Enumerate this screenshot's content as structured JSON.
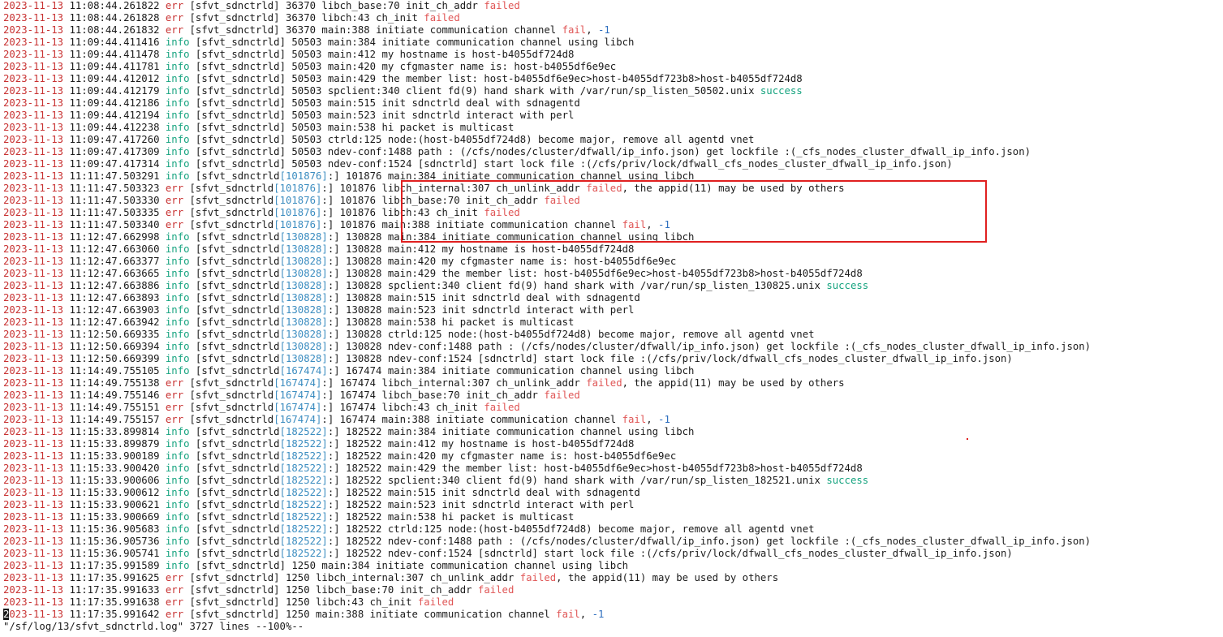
{
  "colors": {
    "date": "#c83232",
    "err": "#c83232",
    "info": "#16a37f",
    "failed": "#e05656",
    "success": "#16a37f",
    "pid_bracket": "#3c8dc0",
    "neg_one": "#2f6fbf",
    "highlight_box": "#e02020"
  },
  "log": {
    "lines": [
      {
        "d": "2023-11-13",
        "t": "11:08:44.261822",
        "l": "err",
        "tag": "[sfvt_sdnctrld]",
        "pid": "",
        "pid2": "36370",
        "src": "libch_base:70",
        "msg": [
          [
            "init_ch_addr ",
            ""
          ],
          [
            "failed",
            "fail"
          ]
        ]
      },
      {
        "d": "2023-11-13",
        "t": "11:08:44.261828",
        "l": "err",
        "tag": "[sfvt_sdnctrld]",
        "pid": "",
        "pid2": "36370",
        "src": "libch:43",
        "msg": [
          [
            "ch_init ",
            ""
          ],
          [
            "failed",
            "fail"
          ]
        ]
      },
      {
        "d": "2023-11-13",
        "t": "11:08:44.261832",
        "l": "err",
        "tag": "[sfvt_sdnctrld]",
        "pid": "",
        "pid2": "36370",
        "src": "main:388",
        "msg": [
          [
            "initiate communication channel ",
            ""
          ],
          [
            "fail",
            "fail"
          ],
          [
            ", ",
            ""
          ],
          [
            "-1",
            "neg"
          ]
        ]
      },
      {
        "d": "2023-11-13",
        "t": "11:09:44.411416",
        "l": "info",
        "tag": "[sfvt_sdnctrld]",
        "pid": "",
        "pid2": "50503",
        "src": "main:384",
        "msg": [
          [
            "initiate communication channel using libch",
            ""
          ]
        ]
      },
      {
        "d": "2023-11-13",
        "t": "11:09:44.411478",
        "l": "info",
        "tag": "[sfvt_sdnctrld]",
        "pid": "",
        "pid2": "50503",
        "src": "main:412",
        "msg": [
          [
            "my hostname is host-b4055df724d8",
            ""
          ]
        ]
      },
      {
        "d": "2023-11-13",
        "t": "11:09:44.411781",
        "l": "info",
        "tag": "[sfvt_sdnctrld]",
        "pid": "",
        "pid2": "50503",
        "src": "main:420",
        "msg": [
          [
            "my cfgmaster name is: host-b4055df6e9ec",
            ""
          ]
        ]
      },
      {
        "d": "2023-11-13",
        "t": "11:09:44.412012",
        "l": "info",
        "tag": "[sfvt_sdnctrld]",
        "pid": "",
        "pid2": "50503",
        "src": "main:429",
        "msg": [
          [
            "the member list: host-b4055df6e9ec>host-b4055df723b8>host-b4055df724d8",
            ""
          ]
        ]
      },
      {
        "d": "2023-11-13",
        "t": "11:09:44.412179",
        "l": "info",
        "tag": "[sfvt_sdnctrld]",
        "pid": "",
        "pid2": "50503",
        "src": "spclient:340",
        "msg": [
          [
            "client fd(9) hand shark with /var/run/sp_listen_50502.unix ",
            ""
          ],
          [
            "success",
            "ok"
          ]
        ]
      },
      {
        "d": "2023-11-13",
        "t": "11:09:44.412186",
        "l": "info",
        "tag": "[sfvt_sdnctrld]",
        "pid": "",
        "pid2": "50503",
        "src": "main:515",
        "msg": [
          [
            "init sdnctrld deal with sdnagentd",
            ""
          ]
        ]
      },
      {
        "d": "2023-11-13",
        "t": "11:09:44.412194",
        "l": "info",
        "tag": "[sfvt_sdnctrld]",
        "pid": "",
        "pid2": "50503",
        "src": "main:523",
        "msg": [
          [
            "init sdnctrld interact with perl",
            ""
          ]
        ]
      },
      {
        "d": "2023-11-13",
        "t": "11:09:44.412238",
        "l": "info",
        "tag": "[sfvt_sdnctrld]",
        "pid": "",
        "pid2": "50503",
        "src": "main:538",
        "msg": [
          [
            "hi packet is multicast",
            ""
          ]
        ]
      },
      {
        "d": "2023-11-13",
        "t": "11:09:47.417260",
        "l": "info",
        "tag": "[sfvt_sdnctrld]",
        "pid": "",
        "pid2": "50503",
        "src": "ctrld:125",
        "msg": [
          [
            "node:(host-b4055df724d8) become major, remove all agentd vnet",
            ""
          ]
        ]
      },
      {
        "d": "2023-11-13",
        "t": "11:09:47.417309",
        "l": "info",
        "tag": "[sfvt_sdnctrld]",
        "pid": "",
        "pid2": "50503",
        "src": "ndev-conf:1488",
        "msg": [
          [
            "path : (/cfs/nodes/cluster/dfwall/ip_info.json) get lockfile :(_cfs_nodes_cluster_dfwall_ip_info.json)",
            ""
          ]
        ]
      },
      {
        "d": "2023-11-13",
        "t": "11:09:47.417314",
        "l": "info",
        "tag": "[sfvt_sdnctrld]",
        "pid": "",
        "pid2": "50503",
        "src": "ndev-conf:1524",
        "msg": [
          [
            "[sdnctrld] start lock file :(/cfs/priv/lock/dfwall_cfs_nodes_cluster_dfwall_ip_info.json)",
            ""
          ]
        ]
      },
      {
        "d": "2023-11-13",
        "t": "11:11:47.503291",
        "l": "info",
        "tag": "[sfvt_sdnctrld",
        "pid": "[101876]",
        "pid2": "101876",
        "src": "main:384",
        "msg": [
          [
            "initiate communication channel using libch",
            ""
          ]
        ]
      },
      {
        "d": "2023-11-13",
        "t": "11:11:47.503323",
        "l": "err",
        "tag": "[sfvt_sdnctrld",
        "pid": "[101876]",
        "pid2": "101876",
        "src": "libch_internal:307",
        "msg": [
          [
            "ch_unlink_addr ",
            ""
          ],
          [
            "failed",
            "fail"
          ],
          [
            ", the appid(11) may be used by others",
            ""
          ]
        ]
      },
      {
        "d": "2023-11-13",
        "t": "11:11:47.503330",
        "l": "err",
        "tag": "[sfvt_sdnctrld",
        "pid": "[101876]",
        "pid2": "101876",
        "src": "libch_base:70",
        "msg": [
          [
            "init_ch_addr ",
            ""
          ],
          [
            "failed",
            "fail"
          ]
        ]
      },
      {
        "d": "2023-11-13",
        "t": "11:11:47.503335",
        "l": "err",
        "tag": "[sfvt_sdnctrld",
        "pid": "[101876]",
        "pid2": "101876",
        "src": "libch:43",
        "msg": [
          [
            "ch_init ",
            ""
          ],
          [
            "failed",
            "fail"
          ]
        ]
      },
      {
        "d": "2023-11-13",
        "t": "11:11:47.503340",
        "l": "err",
        "tag": "[sfvt_sdnctrld",
        "pid": "[101876]",
        "pid2": "101876",
        "src": "main:388",
        "msg": [
          [
            "initiate communication channel ",
            ""
          ],
          [
            "fail",
            "fail"
          ],
          [
            ", ",
            ""
          ],
          [
            "-1",
            "neg"
          ]
        ]
      },
      {
        "d": "2023-11-13",
        "t": "11:12:47.662998",
        "l": "info",
        "tag": "[sfvt_sdnctrld",
        "pid": "[130828]",
        "pid2": "130828",
        "src": "main:384",
        "msg": [
          [
            "initiate communication channel using libch",
            ""
          ]
        ]
      },
      {
        "d": "2023-11-13",
        "t": "11:12:47.663060",
        "l": "info",
        "tag": "[sfvt_sdnctrld",
        "pid": "[130828]",
        "pid2": "130828",
        "src": "main:412",
        "msg": [
          [
            "my hostname is host-b4055df724d8",
            ""
          ]
        ]
      },
      {
        "d": "2023-11-13",
        "t": "11:12:47.663377",
        "l": "info",
        "tag": "[sfvt_sdnctrld",
        "pid": "[130828]",
        "pid2": "130828",
        "src": "main:420",
        "msg": [
          [
            "my cfgmaster name is: host-b4055df6e9ec",
            ""
          ]
        ]
      },
      {
        "d": "2023-11-13",
        "t": "11:12:47.663665",
        "l": "info",
        "tag": "[sfvt_sdnctrld",
        "pid": "[130828]",
        "pid2": "130828",
        "src": "main:429",
        "msg": [
          [
            "the member list: host-b4055df6e9ec>host-b4055df723b8>host-b4055df724d8",
            ""
          ]
        ]
      },
      {
        "d": "2023-11-13",
        "t": "11:12:47.663886",
        "l": "info",
        "tag": "[sfvt_sdnctrld",
        "pid": "[130828]",
        "pid2": "130828",
        "src": "spclient:340",
        "msg": [
          [
            "client fd(9) hand shark with /var/run/sp_listen_130825.unix ",
            ""
          ],
          [
            "success",
            "ok"
          ]
        ]
      },
      {
        "d": "2023-11-13",
        "t": "11:12:47.663893",
        "l": "info",
        "tag": "[sfvt_sdnctrld",
        "pid": "[130828]",
        "pid2": "130828",
        "src": "main:515",
        "msg": [
          [
            "init sdnctrld deal with sdnagentd",
            ""
          ]
        ]
      },
      {
        "d": "2023-11-13",
        "t": "11:12:47.663903",
        "l": "info",
        "tag": "[sfvt_sdnctrld",
        "pid": "[130828]",
        "pid2": "130828",
        "src": "main:523",
        "msg": [
          [
            "init sdnctrld interact with perl",
            ""
          ]
        ]
      },
      {
        "d": "2023-11-13",
        "t": "11:12:47.663942",
        "l": "info",
        "tag": "[sfvt_sdnctrld",
        "pid": "[130828]",
        "pid2": "130828",
        "src": "main:538",
        "msg": [
          [
            "hi packet is multicast",
            ""
          ]
        ]
      },
      {
        "d": "2023-11-13",
        "t": "11:12:50.669335",
        "l": "info",
        "tag": "[sfvt_sdnctrld",
        "pid": "[130828]",
        "pid2": "130828",
        "src": "ctrld:125",
        "msg": [
          [
            "node:(host-b4055df724d8) become major, remove all agentd vnet",
            ""
          ]
        ]
      },
      {
        "d": "2023-11-13",
        "t": "11:12:50.669394",
        "l": "info",
        "tag": "[sfvt_sdnctrld",
        "pid": "[130828]",
        "pid2": "130828",
        "src": "ndev-conf:1488",
        "msg": [
          [
            "path : (/cfs/nodes/cluster/dfwall/ip_info.json) get lockfile :(_cfs_nodes_cluster_dfwall_ip_info.json)",
            ""
          ]
        ]
      },
      {
        "d": "2023-11-13",
        "t": "11:12:50.669399",
        "l": "info",
        "tag": "[sfvt_sdnctrld",
        "pid": "[130828]",
        "pid2": "130828",
        "src": "ndev-conf:1524",
        "msg": [
          [
            "[sdnctrld] start lock file :(/cfs/priv/lock/dfwall_cfs_nodes_cluster_dfwall_ip_info.json)",
            ""
          ]
        ]
      },
      {
        "d": "2023-11-13",
        "t": "11:14:49.755105",
        "l": "info",
        "tag": "[sfvt_sdnctrld",
        "pid": "[167474]",
        "pid2": "167474",
        "src": "main:384",
        "msg": [
          [
            "initiate communication channel using libch",
            ""
          ]
        ]
      },
      {
        "d": "2023-11-13",
        "t": "11:14:49.755138",
        "l": "err",
        "tag": "[sfvt_sdnctrld",
        "pid": "[167474]",
        "pid2": "167474",
        "src": "libch_internal:307",
        "msg": [
          [
            "ch_unlink_addr ",
            ""
          ],
          [
            "failed",
            "fail"
          ],
          [
            ", the appid(11) may be used by others",
            ""
          ]
        ]
      },
      {
        "d": "2023-11-13",
        "t": "11:14:49.755146",
        "l": "err",
        "tag": "[sfvt_sdnctrld",
        "pid": "[167474]",
        "pid2": "167474",
        "src": "libch_base:70",
        "msg": [
          [
            "init_ch_addr ",
            ""
          ],
          [
            "failed",
            "fail"
          ]
        ]
      },
      {
        "d": "2023-11-13",
        "t": "11:14:49.755151",
        "l": "err",
        "tag": "[sfvt_sdnctrld",
        "pid": "[167474]",
        "pid2": "167474",
        "src": "libch:43",
        "msg": [
          [
            "ch_init ",
            ""
          ],
          [
            "failed",
            "fail"
          ]
        ]
      },
      {
        "d": "2023-11-13",
        "t": "11:14:49.755157",
        "l": "err",
        "tag": "[sfvt_sdnctrld",
        "pid": "[167474]",
        "pid2": "167474",
        "src": "main:388",
        "msg": [
          [
            "initiate communication channel ",
            ""
          ],
          [
            "fail",
            "fail"
          ],
          [
            ", ",
            ""
          ],
          [
            "-1",
            "neg"
          ]
        ]
      },
      {
        "d": "2023-11-13",
        "t": "11:15:33.899814",
        "l": "info",
        "tag": "[sfvt_sdnctrld",
        "pid": "[182522]",
        "pid2": "182522",
        "src": "main:384",
        "msg": [
          [
            "initiate communication channel using libch",
            ""
          ]
        ]
      },
      {
        "d": "2023-11-13",
        "t": "11:15:33.899879",
        "l": "info",
        "tag": "[sfvt_sdnctrld",
        "pid": "[182522]",
        "pid2": "182522",
        "src": "main:412",
        "msg": [
          [
            "my hostname is host-b4055df724d8",
            ""
          ]
        ]
      },
      {
        "d": "2023-11-13",
        "t": "11:15:33.900189",
        "l": "info",
        "tag": "[sfvt_sdnctrld",
        "pid": "[182522]",
        "pid2": "182522",
        "src": "main:420",
        "msg": [
          [
            "my cfgmaster name is: host-b4055df6e9ec",
            ""
          ]
        ]
      },
      {
        "d": "2023-11-13",
        "t": "11:15:33.900420",
        "l": "info",
        "tag": "[sfvt_sdnctrld",
        "pid": "[182522]",
        "pid2": "182522",
        "src": "main:429",
        "msg": [
          [
            "the member list: host-b4055df6e9ec>host-b4055df723b8>host-b4055df724d8",
            ""
          ]
        ]
      },
      {
        "d": "2023-11-13",
        "t": "11:15:33.900606",
        "l": "info",
        "tag": "[sfvt_sdnctrld",
        "pid": "[182522]",
        "pid2": "182522",
        "src": "spclient:340",
        "msg": [
          [
            "client fd(9) hand shark with /var/run/sp_listen_182521.unix ",
            ""
          ],
          [
            "success",
            "ok"
          ]
        ]
      },
      {
        "d": "2023-11-13",
        "t": "11:15:33.900612",
        "l": "info",
        "tag": "[sfvt_sdnctrld",
        "pid": "[182522]",
        "pid2": "182522",
        "src": "main:515",
        "msg": [
          [
            "init sdnctrld deal with sdnagentd",
            ""
          ]
        ]
      },
      {
        "d": "2023-11-13",
        "t": "11:15:33.900621",
        "l": "info",
        "tag": "[sfvt_sdnctrld",
        "pid": "[182522]",
        "pid2": "182522",
        "src": "main:523",
        "msg": [
          [
            "init sdnctrld interact with perl",
            ""
          ]
        ]
      },
      {
        "d": "2023-11-13",
        "t": "11:15:33.900669",
        "l": "info",
        "tag": "[sfvt_sdnctrld",
        "pid": "[182522]",
        "pid2": "182522",
        "src": "main:538",
        "msg": [
          [
            "hi packet is multicast",
            ""
          ]
        ]
      },
      {
        "d": "2023-11-13",
        "t": "11:15:36.905683",
        "l": "info",
        "tag": "[sfvt_sdnctrld",
        "pid": "[182522]",
        "pid2": "182522",
        "src": "ctrld:125",
        "msg": [
          [
            "node:(host-b4055df724d8) become major, remove all agentd vnet",
            ""
          ]
        ]
      },
      {
        "d": "2023-11-13",
        "t": "11:15:36.905736",
        "l": "info",
        "tag": "[sfvt_sdnctrld",
        "pid": "[182522]",
        "pid2": "182522",
        "src": "ndev-conf:1488",
        "msg": [
          [
            "path : (/cfs/nodes/cluster/dfwall/ip_info.json) get lockfile :(_cfs_nodes_cluster_dfwall_ip_info.json)",
            ""
          ]
        ]
      },
      {
        "d": "2023-11-13",
        "t": "11:15:36.905741",
        "l": "info",
        "tag": "[sfvt_sdnctrld",
        "pid": "[182522]",
        "pid2": "182522",
        "src": "ndev-conf:1524",
        "msg": [
          [
            "[sdnctrld] start lock file :(/cfs/priv/lock/dfwall_cfs_nodes_cluster_dfwall_ip_info.json)",
            ""
          ]
        ]
      },
      {
        "d": "2023-11-13",
        "t": "11:17:35.991589",
        "l": "info",
        "tag": "[sfvt_sdnctrld]",
        "pid": "",
        "pid2": "1250",
        "src": "main:384",
        "msg": [
          [
            "initiate communication channel using libch",
            ""
          ]
        ]
      },
      {
        "d": "2023-11-13",
        "t": "11:17:35.991625",
        "l": "err",
        "tag": "[sfvt_sdnctrld]",
        "pid": "",
        "pid2": "1250",
        "src": "libch_internal:307",
        "msg": [
          [
            "ch_unlink_addr ",
            ""
          ],
          [
            "failed",
            "fail"
          ],
          [
            ", the appid(11) may be used by others",
            ""
          ]
        ]
      },
      {
        "d": "2023-11-13",
        "t": "11:17:35.991633",
        "l": "err",
        "tag": "[sfvt_sdnctrld]",
        "pid": "",
        "pid2": "1250",
        "src": "libch_base:70",
        "msg": [
          [
            "init_ch_addr ",
            ""
          ],
          [
            "failed",
            "fail"
          ]
        ]
      },
      {
        "d": "2023-11-13",
        "t": "11:17:35.991638",
        "l": "err",
        "tag": "[sfvt_sdnctrld]",
        "pid": "",
        "pid2": "1250",
        "src": "libch:43",
        "msg": [
          [
            "ch_init ",
            ""
          ],
          [
            "failed",
            "fail"
          ]
        ]
      },
      {
        "d": "2023-11-13",
        "t": "11:17:35.991642",
        "l": "err",
        "tag": "[sfvt_sdnctrld]",
        "pid": "",
        "pid2": "1250",
        "src": "main:388",
        "msg": [
          [
            "initiate communication channel ",
            ""
          ],
          [
            "fail",
            "fail"
          ],
          [
            ", ",
            ""
          ],
          [
            "-1",
            "neg"
          ]
        ]
      }
    ]
  },
  "status": {
    "text": "\"/sf/log/13/sfvt_sdnctrld.log\" 3727 lines --100%--"
  }
}
